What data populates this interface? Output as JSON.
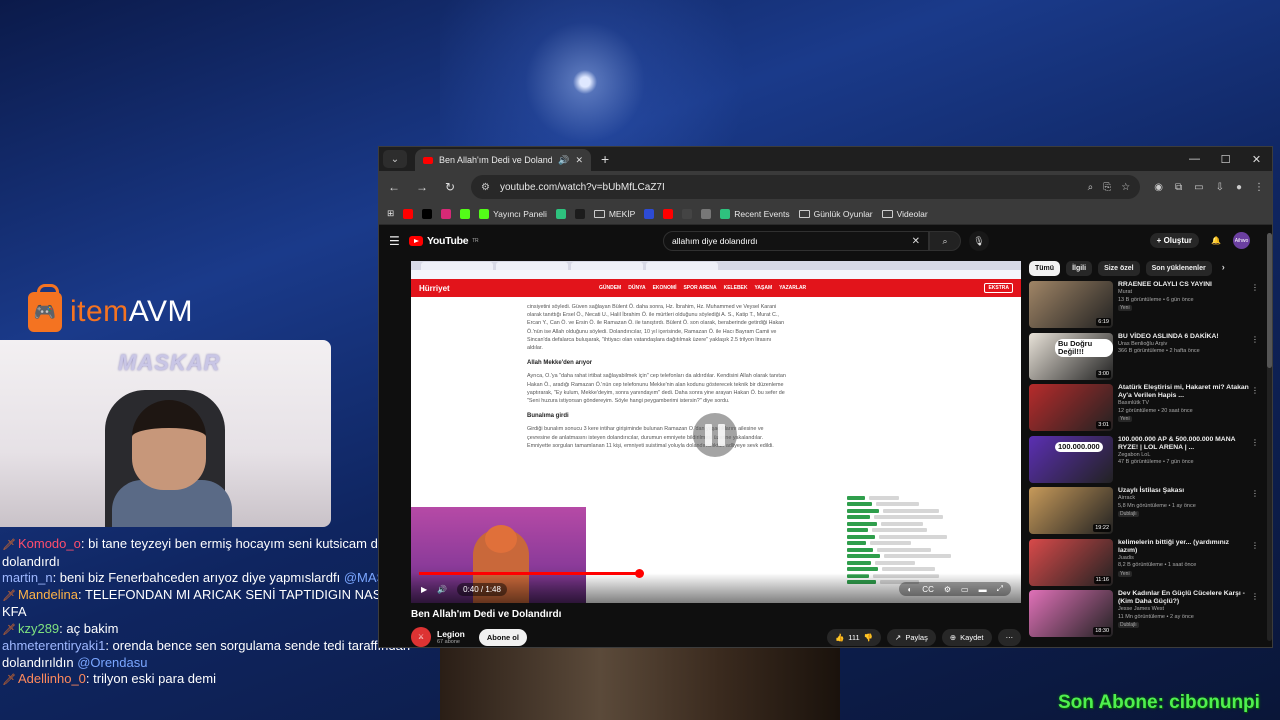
{
  "overlay": {
    "logo_item": "item",
    "logo_avm": "AVM",
    "webcam_watermark": "MASKAR",
    "sub_banner": "Son Abone: cibonunpi"
  },
  "chat": [
    {
      "user": "Komodo_o",
      "color": "#ff4d6d",
      "badge": true,
      "text": ": bi tane teyzeyi ben ermiş hocayım seni kutsicam dedi dolandırdı",
      "mention": ""
    },
    {
      "user": "martin_n",
      "color": "#9fb8ff",
      "badge": false,
      "text": ": beni biz Fenerbahceden arıyoz diye yapmıslardfı",
      "mention": "@MASKAR"
    },
    {
      "user": "Mandelina",
      "color": "#ffb347",
      "badge": true,
      "text": ": TELEFONDAN MI ARICAK SENİ TAPTIDIGIN NASI Bİ KFA",
      "mention": ""
    },
    {
      "user": "kzy289",
      "color": "#7fe27f",
      "badge": true,
      "text": ": aç bakim",
      "mention": ""
    },
    {
      "user": "ahmeterentiryaki1",
      "color": "#9fb8ff",
      "badge": false,
      "text": ": orenda bence sen sorgulama sende tedi taraffından dolandırıldın",
      "mention": "@Orendasu"
    },
    {
      "user": "Adellinho_0",
      "color": "#ff8a5c",
      "badge": true,
      "text": ": trilyon eski para demi",
      "mention": ""
    }
  ],
  "browser": {
    "tab_title": "Ben Allah'ım Dedi ve Dolandı",
    "url": "youtube.com/watch?v=bUbMfLCaZ7I",
    "bookmarks": [
      {
        "label": "",
        "color": "#ff0000"
      },
      {
        "label": "",
        "color": "#000000"
      },
      {
        "label": "",
        "color": "#d62976"
      },
      {
        "label": "",
        "color": "#53fc18"
      },
      {
        "label": "Yayıncı Paneli",
        "color": "#53fc18"
      },
      {
        "label": "",
        "color": "#2ec27e"
      },
      {
        "label": "",
        "color": "#1c1c1c"
      },
      {
        "label": "MEKİP",
        "color": "folder"
      },
      {
        "label": "",
        "color": "#2d4bd4"
      },
      {
        "label": "",
        "color": "#ff0000"
      },
      {
        "label": "",
        "color": "#444444"
      },
      {
        "label": "",
        "color": "#777777"
      },
      {
        "label": "Recent Events",
        "color": "#2ec27e"
      },
      {
        "label": "Günlük Oyunlar",
        "color": "folder"
      },
      {
        "label": "Videolar",
        "color": "folder"
      }
    ],
    "window_controls": [
      "—",
      "☐",
      "✕"
    ]
  },
  "youtube": {
    "logo": "YouTube",
    "logo_sup": "TR",
    "search_query": "allahım diye dolandırdı",
    "create_label": "Oluştur",
    "avatar_label": "Aihwo",
    "video_title": "Ben Allah'ım Dedi ve Dolandırdı",
    "channel_name": "Legion",
    "channel_subs": "67 abone",
    "subscribe_label": "Abone ol",
    "likes": "111",
    "share_label": "Paylaş",
    "save_label": "Kaydet",
    "time_current": "0:40",
    "time_total": "1:48",
    "progress": 0.37,
    "chips": [
      "Tümü",
      "İlgili",
      "Size özel",
      "Son yüklenenler"
    ],
    "recommendations": [
      {
        "title": "RRAENEE OLAYLI CS YAYINI",
        "channel": "Murat",
        "stats": "13 B görüntüleme • 6 gün önce",
        "tag": "Yeni",
        "duration": "6:19",
        "thumb": "#a08566",
        "overlay": ""
      },
      {
        "title": "BU VİDEO ASLINDA 6 DAKİKA!",
        "channel": "Uras Benlioğlu Arşiv",
        "stats": "366 B görüntüleme • 2 hafta önce",
        "tag": "",
        "duration": "3:00",
        "thumb": "#e8e2d8",
        "overlay": "Bu Doğru Değil!!!"
      },
      {
        "title": "Atatürk Eleştirisi mi, Hakaret mi? Atakan Ay'a Verilen Hapis ...",
        "channel": "Basınlütk TV",
        "stats": "12 görüntüleme • 20 saat önce",
        "tag": "Yeni",
        "duration": "3:01",
        "thumb": "#b72b2b",
        "overlay": ""
      },
      {
        "title": "100.000.000 AP & 500.000.000 MANA RYZE! | LOL ARENA | ...",
        "channel": "Zegabon LoL",
        "stats": "47 B görüntüleme • 7 gün önce",
        "tag": "",
        "duration": "",
        "thumb": "#5b2fb3",
        "overlay": "100.000.000"
      },
      {
        "title": "Uzaylı İstilası Şakası",
        "channel": "Airrack",
        "stats": "5,8 Mn görüntüleme • 1 ay önce",
        "tag": "Dublajlı",
        "duration": "19:22",
        "thumb": "#c79a5a",
        "overlay": ""
      },
      {
        "title": "kelimelerin bittiği yer... (yardımınız lazım)",
        "channel": "Juadis",
        "stats": "8,2 B görüntüleme • 1 saat önce",
        "tag": "Yeni",
        "duration": "11:16",
        "thumb": "#d84a4a",
        "overlay": ""
      },
      {
        "title": "Dev Kadınlar En Güçlü Cücelere Karşı - (Kim Daha Güçlü?)",
        "channel": "Jesse James West",
        "stats": "11 Mn görüntüleme • 2 ay önce",
        "tag": "Dublajlı",
        "duration": "18:30",
        "thumb": "#e071b8",
        "overlay": ""
      }
    ]
  },
  "inner_page": {
    "brand": "Hürriyet",
    "menu": [
      "GÜNDEM",
      "DÜNYA",
      "EKONOMİ",
      "SPOR ARENA",
      "KELEBEK",
      "YAŞAM",
      "YAZARLAR"
    ],
    "extra": "EKSTRA",
    "p1": "cinsiyetini söyledi. Güven sağlayan Bülent Ö. daha sonra, Hz. İbrahim, Hz. Muhammed ve Veysel Karani olarak tanıttığı Ersel Ö., Necati U., Halil İbrahim Ö. ile mürtleri olduğunu söylediği A. S., Katip T., Murat C., Ercan Y., Can Ö. ve Ersin Ö. ile Ramazan Ö. ile tanıştırdı. Bülent Ö. son olarak, beraberinde getirdiği Hakan Ö.'nün ise Allah olduğunu söyledi. Dolandırıcılar, 10 yıl içerisinde, Ramazan Ö. ile Hacı Bayram Camii ve Sincan'da defalarca buluşarak, \"ihtiyacı olan vatandaşlara dağıtılmak üzere\" yaklaşık 2.5 trilyon lirasını aldılar.",
    "h1": "Allah Mekke'den arıyor",
    "p2": "Ayrıca, O.'ya \"daha rahat irtibat sağlayabilmek için\" cep telefonları da aldırdılar. Kendisini Allah olarak tanıtan Hakan Ö., aradığı Ramazan Ö.'nün cep telefonunu Mekke'nin alan kodunu gösterecek teknik bir düzenleme yaptırarak, \"Ey kulum, Mekke'deyim, sonra yanındayım\" dedi. Daha sonra yine arayan Hakan Ö. bu sefer de \"Seni huzura istiyorsan göndereyim. Söyle hangi peygamberimi istersin?\" diye sordu.",
    "h2": "Bunalıma girdi",
    "p3": "Girdiği bunalım sonucu 3 kere intihar girişiminde bulunan Ramazan O.'dan yaşadıklarını ailesine ve çevresine de anlatmasını isteyen dolandırıcılar, durumun emniyete bildirilmesi üzerine yakalandılar. Emniyette sorguları tamamlanan 11 kişi, emniyeti suistimal yoluyla dolandırıcılıktan adliyeye sevk edildi."
  }
}
